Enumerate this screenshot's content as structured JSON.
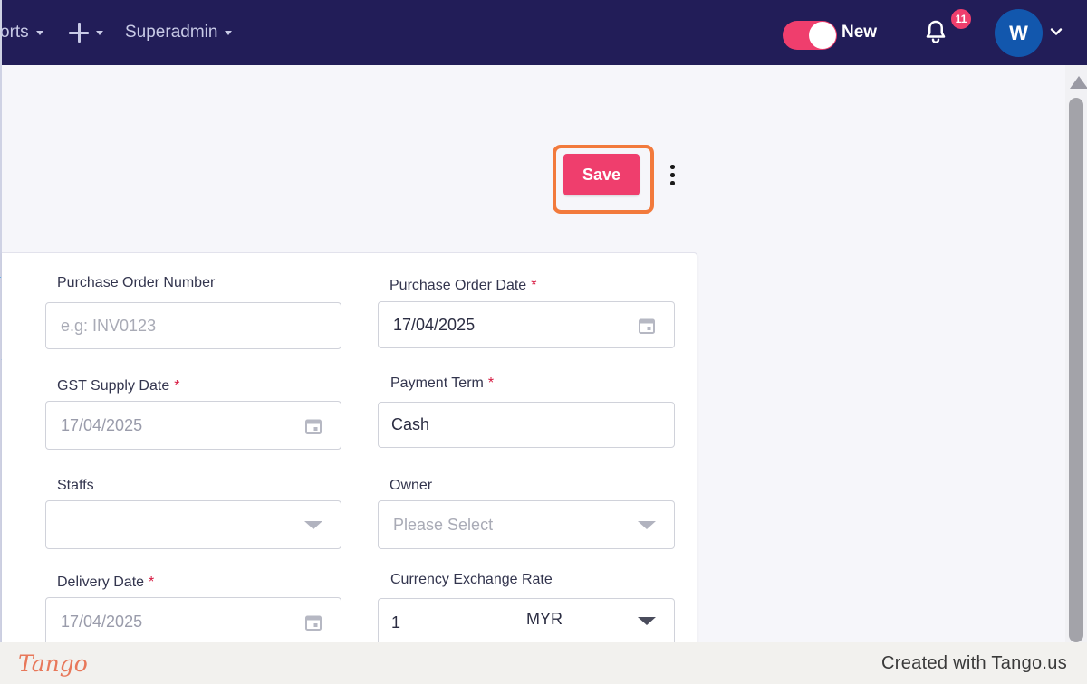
{
  "nav": {
    "reports_label": "orts",
    "superadmin_label": "Superadmin",
    "toggle_label": "New",
    "notification_count": "11",
    "avatar_initial": "W"
  },
  "toolbar": {
    "save_label": "Save"
  },
  "form": {
    "po_number": {
      "label": "Purchase Order Number",
      "placeholder": "e.g: INV0123"
    },
    "po_date": {
      "label": "Purchase Order Date",
      "required_mark": "*",
      "value": "17/04/2025"
    },
    "gst_supply_date": {
      "label": "GST Supply Date",
      "required_mark": "*",
      "value": "17/04/2025"
    },
    "payment_term": {
      "label": "Payment Term",
      "required_mark": "*",
      "value": "Cash"
    },
    "staffs": {
      "label": "Staffs",
      "value": ""
    },
    "owner": {
      "label": "Owner",
      "placeholder": "Please Select"
    },
    "delivery_date": {
      "label": "Delivery Date",
      "required_mark": "*",
      "value": "17/04/2025"
    },
    "currency_exchange": {
      "label": "Currency Exchange Rate",
      "rate": "1",
      "currency": "MYR"
    }
  },
  "footer": {
    "logo_text": "Tango",
    "credit": "Created with Tango.us"
  },
  "colors": {
    "nav_bg": "#221d58",
    "accent": "#ef3e6d",
    "highlight": "#f27a3c",
    "avatar_bg": "#1257ad"
  },
  "icons": [
    "caret-down-icon",
    "plus-icon",
    "bell-icon",
    "chevron-down-icon",
    "kebab-icon",
    "calendar-icon"
  ]
}
